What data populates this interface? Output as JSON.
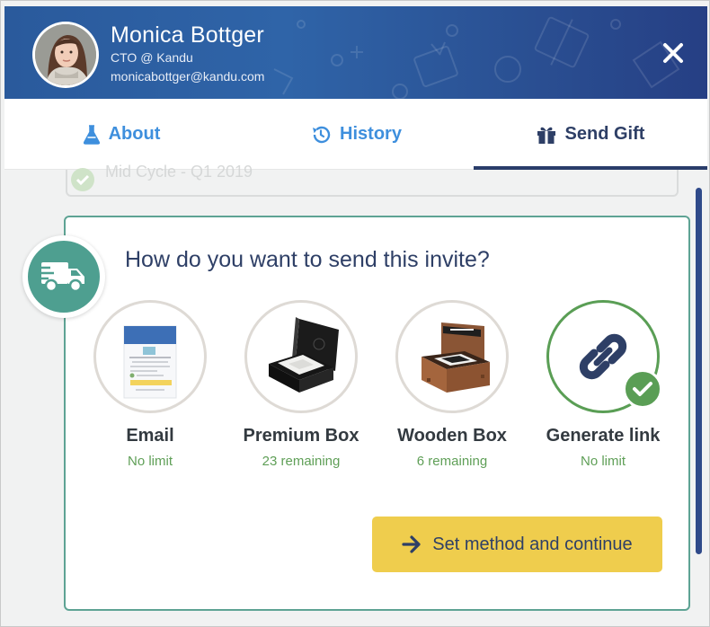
{
  "profile": {
    "name": "Monica Bottger",
    "role": "CTO @ Kandu",
    "email": "monicabottger@kandu.com"
  },
  "tabs": [
    {
      "label": "About",
      "icon": "flask-icon",
      "active": false
    },
    {
      "label": "History",
      "icon": "history-icon",
      "active": false
    },
    {
      "label": "Send Gift",
      "icon": "gift-icon",
      "active": true
    }
  ],
  "background_item": {
    "label": "Mid Cycle - Q1 2019"
  },
  "card": {
    "question": "How do you want to send this invite?",
    "options": [
      {
        "label": "Email",
        "sub": "No limit",
        "selected": false
      },
      {
        "label": "Premium Box",
        "sub": "23 remaining",
        "selected": false
      },
      {
        "label": "Wooden Box",
        "sub": "6 remaining",
        "selected": false
      },
      {
        "label": "Generate link",
        "sub": "No limit",
        "selected": true
      }
    ],
    "cta": "Set method and continue"
  },
  "colors": {
    "header": "#2f64a8",
    "accent_blue": "#3e8fdd",
    "navy": "#2e3f66",
    "teal": "#4e9f90",
    "green": "#5a9e55",
    "cta_yellow": "#efcd4d"
  }
}
